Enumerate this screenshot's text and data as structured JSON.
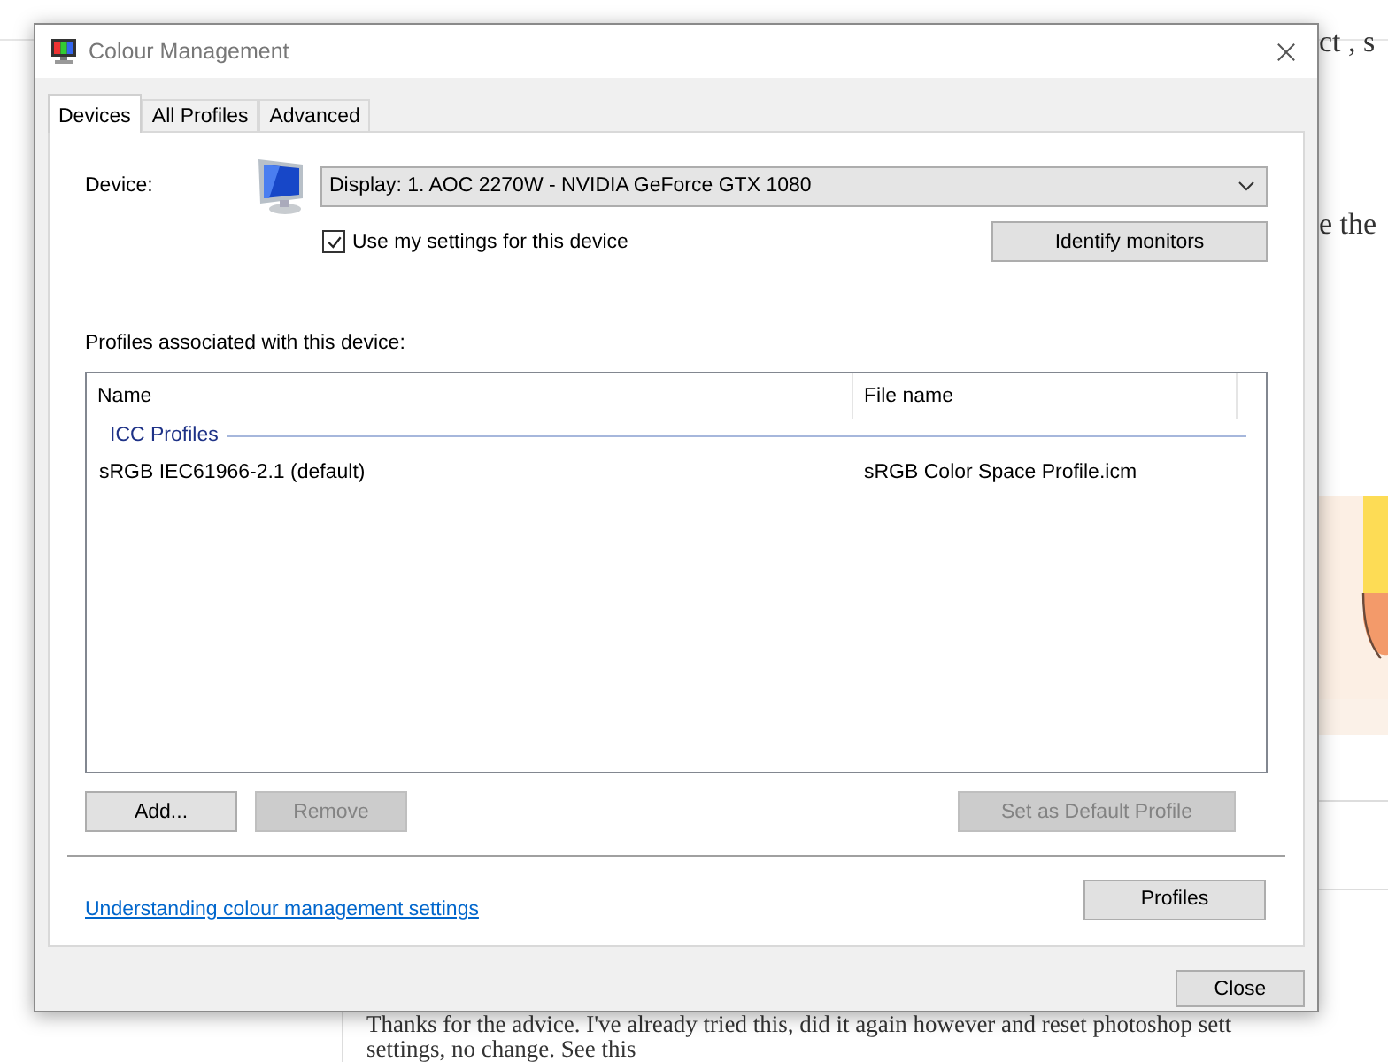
{
  "background_page": {
    "snippets": [
      "ct , s",
      "e the"
    ],
    "paragraph_lines": [
      "Thanks for the advice. I've already tried this, did it again however and reset photoshop sett",
      "settings, no change. See this"
    ]
  },
  "window": {
    "title": "Colour Management"
  },
  "tabs": [
    {
      "label": "Devices",
      "selected": true
    },
    {
      "label": "All Profiles",
      "selected": false
    },
    {
      "label": "Advanced",
      "selected": false
    }
  ],
  "device": {
    "label": "Device:",
    "value": "Display: 1. AOC 2270W - NVIDIA GeForce GTX 1080"
  },
  "use_my_settings": {
    "label": "Use my settings for this device",
    "checked": true
  },
  "identify_button": "Identify monitors",
  "profiles_label": "Profiles associated with this device:",
  "profiles_list": {
    "columns": [
      "Name",
      "File name"
    ],
    "groups": [
      {
        "title": "ICC Profiles",
        "rows": [
          {
            "name": "sRGB IEC61966-2.1 (default)",
            "file": "sRGB Color Space Profile.icm"
          }
        ]
      }
    ]
  },
  "list_buttons": [
    {
      "label": "Add...",
      "disabled": false
    },
    {
      "label": "Remove",
      "disabled": true
    },
    {
      "label": "Set as Default Profile",
      "disabled": true
    }
  ],
  "help_link": "Understanding colour management settings",
  "profiles_button": "Profiles",
  "close_button": "Close"
}
